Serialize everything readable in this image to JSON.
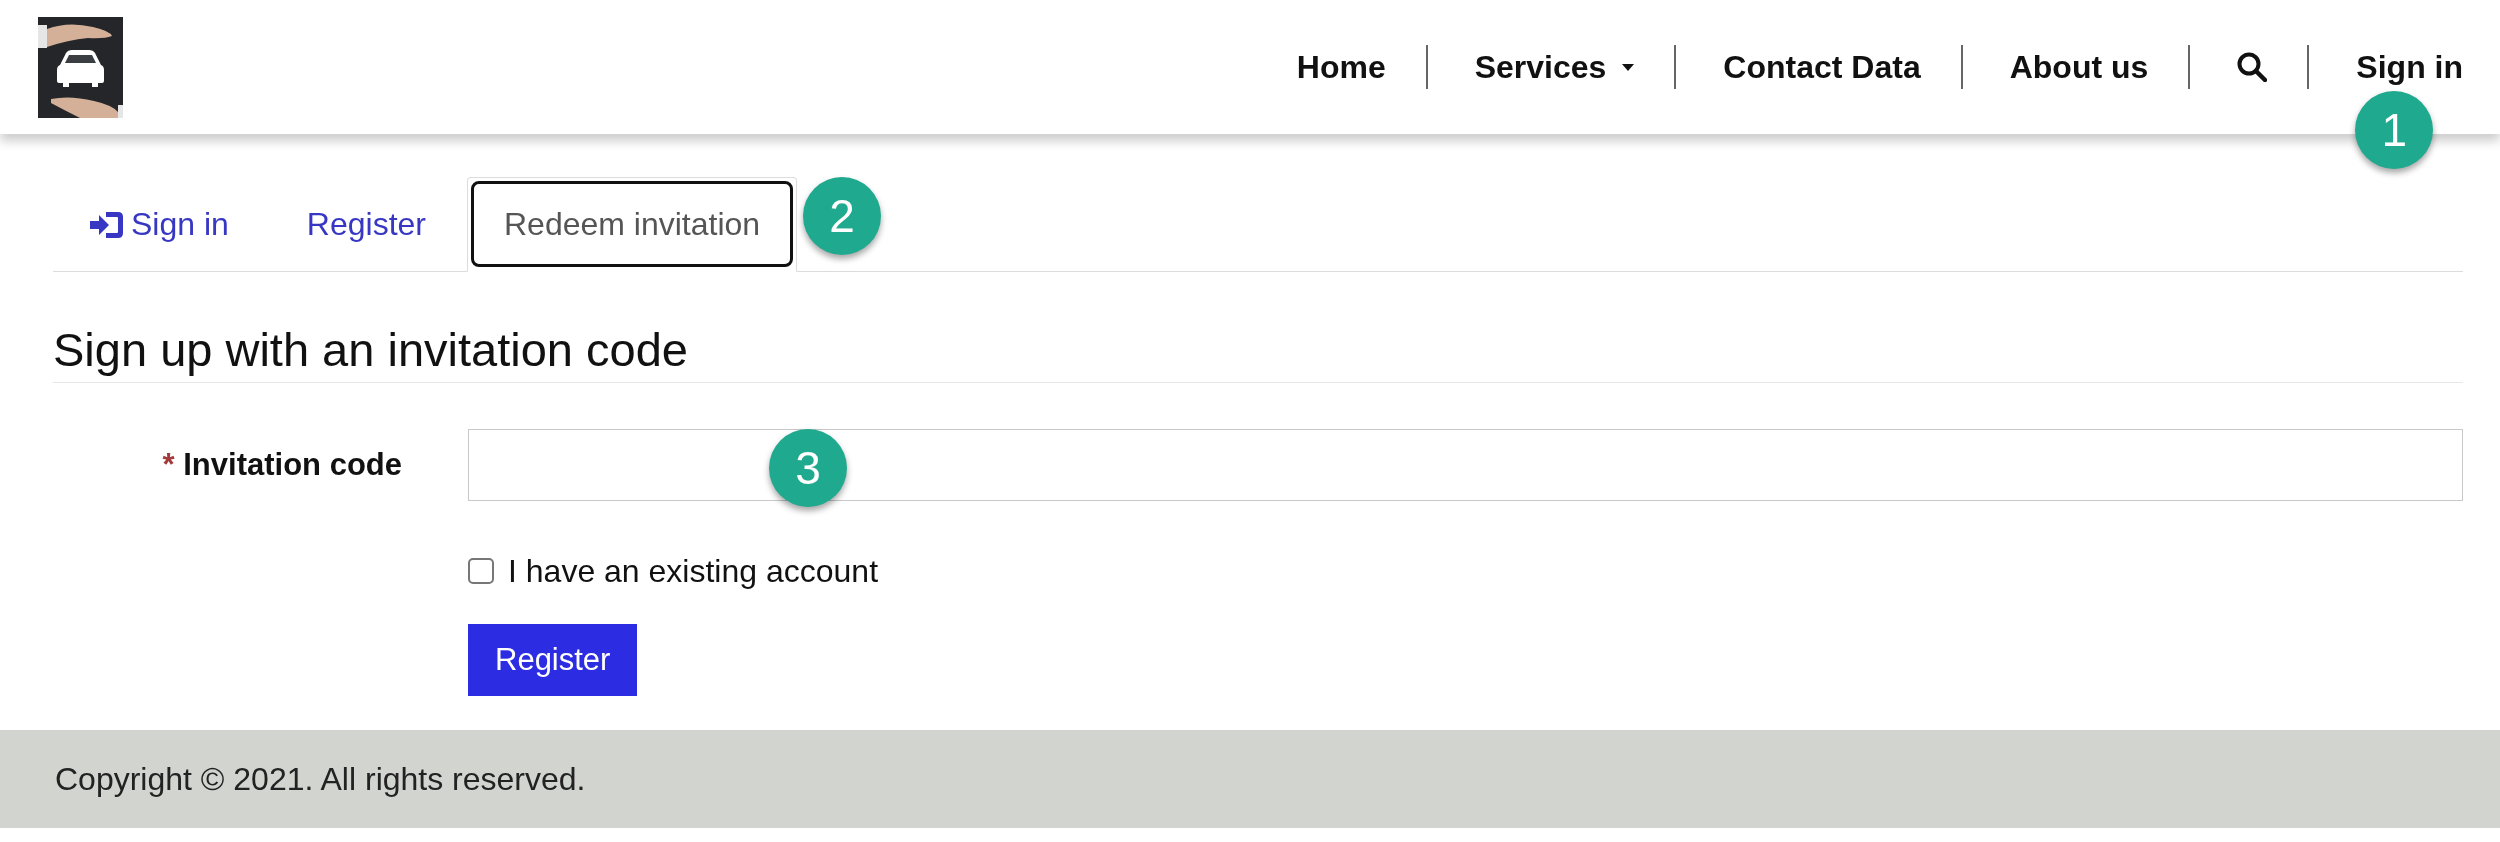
{
  "header": {
    "nav": [
      {
        "label": "Home",
        "kind": "link"
      },
      {
        "label": "Services",
        "kind": "dropdown"
      },
      {
        "label": "Contact Data",
        "kind": "link"
      },
      {
        "label": "About us",
        "kind": "link"
      },
      {
        "kind": "search"
      },
      {
        "label": "Sign in",
        "kind": "link",
        "callout": "1"
      }
    ]
  },
  "tabs": [
    {
      "label": "Sign in",
      "kind": "icon",
      "selected": false,
      "focused": false
    },
    {
      "label": "Register",
      "kind": "text",
      "selected": false,
      "focused": false
    },
    {
      "label": "Redeem invitation",
      "kind": "text",
      "selected": true,
      "focused": true,
      "callout": "2"
    }
  ],
  "heading": "Sign up with an invitation code",
  "form": {
    "field": {
      "label": "Invitation code",
      "required": true,
      "required_mark": "*",
      "callout": "3"
    },
    "checkbox": {
      "label": "I have an existing account",
      "checked": false
    },
    "submit": {
      "label": "Register"
    }
  },
  "footer": {
    "text": "Copyright © 2021. All rights reserved."
  }
}
